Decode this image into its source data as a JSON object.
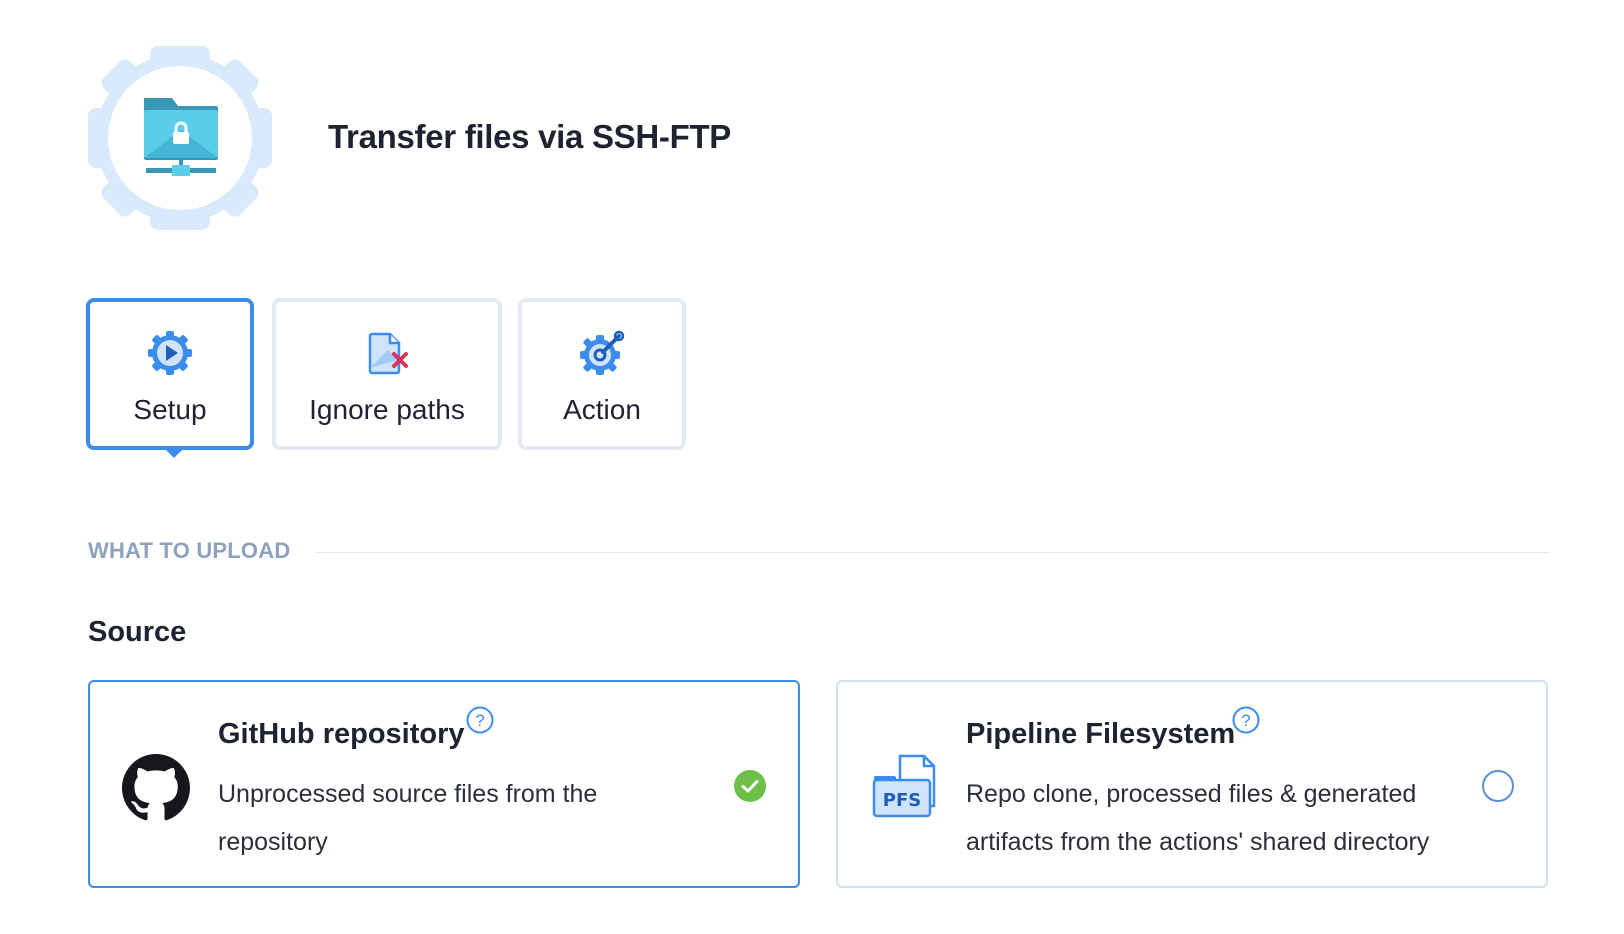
{
  "header": {
    "title": "Transfer files via SSH-FTP",
    "logo_icon": "sftp-folder-lock-icon"
  },
  "tabs": [
    {
      "label": "Setup",
      "icon": "gear-play-icon",
      "active": true
    },
    {
      "label": "Ignore paths",
      "icon": "file-delete-icon",
      "active": false
    },
    {
      "label": "Action",
      "icon": "gear-wrench-icon",
      "active": false
    }
  ],
  "section": {
    "heading": "WHAT TO UPLOAD"
  },
  "source": {
    "label": "Source",
    "options": [
      {
        "title": "GitHub repository",
        "description": "Unprocessed source files from the repository",
        "icon": "github-icon",
        "selected": true
      },
      {
        "title": "Pipeline Filesystem",
        "description": "Repo clone, processed files & generated artifacts from the actions' shared directory",
        "icon": "pfs-icon",
        "icon_text": "PFS",
        "selected": false
      }
    ]
  },
  "colors": {
    "accent": "#3b8ced",
    "muted_heading": "#8ea1bd",
    "success": "#6cc04a",
    "border": "#d6e1ee"
  }
}
